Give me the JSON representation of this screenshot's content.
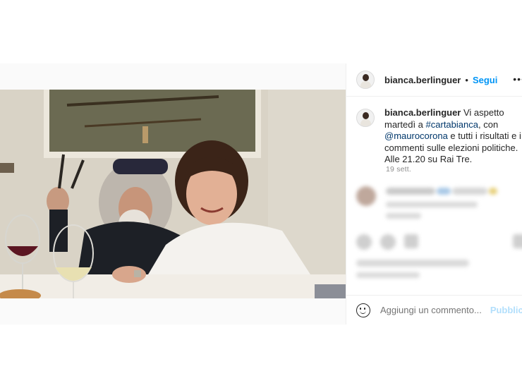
{
  "post": {
    "username": "bianca.berlinguer",
    "separator": "•",
    "follow_label": "Segui",
    "more_icon": "more-horizontal-icon",
    "caption": {
      "username": "bianca.berlinguer",
      "part1": "Vi aspetto martedì a ",
      "hashtag": "#cartabianca",
      "part2": ", con ",
      "mention": "@maurocorona",
      "part3": " e tutti i risultati e i commenti sulle elezioni politiche. Alle 21.20 su Rai Tre."
    },
    "date": "19 sett.",
    "comment_placeholder": "Aggiungi un commento...",
    "publish_label": "Pubblica",
    "emoji_icon": "emoji-smile-icon",
    "colors": {
      "link": "#00376b",
      "follow": "#0095f6",
      "publish_disabled": "#b2dffc"
    }
  }
}
